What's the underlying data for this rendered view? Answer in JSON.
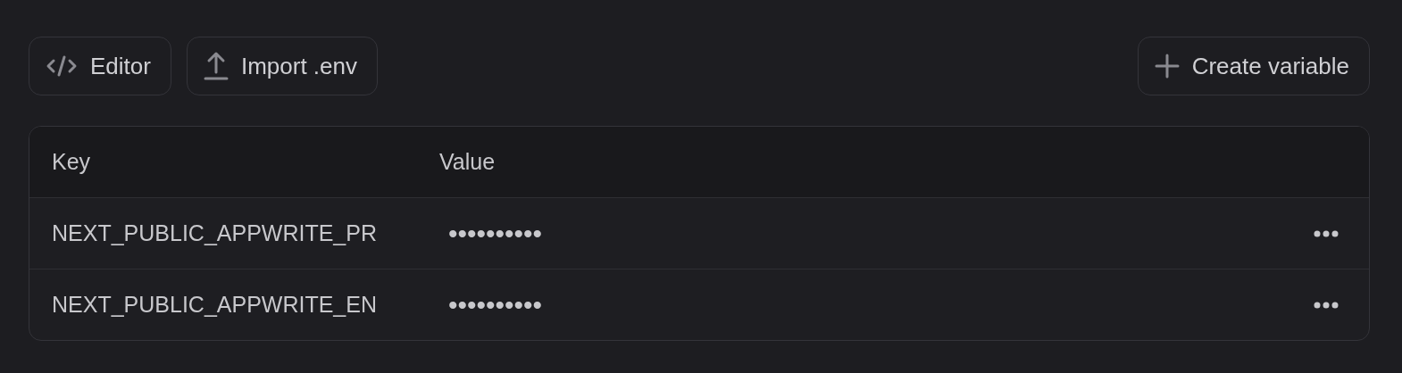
{
  "toolbar": {
    "buttons": [
      {
        "label": "Editor"
      },
      {
        "label": "Import .env"
      }
    ],
    "create_button": {
      "label": "Create variable"
    }
  },
  "table": {
    "columns": [
      "Key",
      "Value"
    ],
    "rows": [
      {
        "key": "NEXT_PUBLIC_APPWRITE_PR",
        "value": "••••••••••"
      },
      {
        "key": "NEXT_PUBLIC_APPWRITE_EN",
        "value": "••••••••••"
      }
    ]
  }
}
